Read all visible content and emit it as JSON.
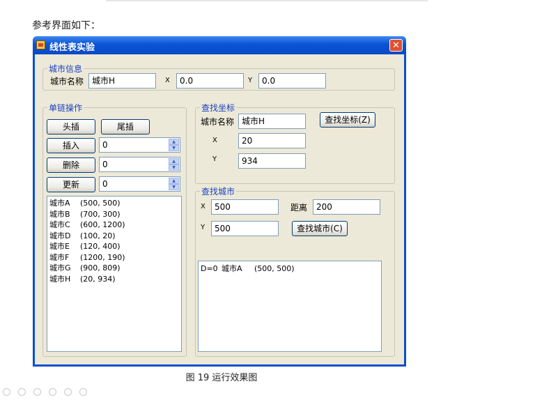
{
  "document": {
    "intro": "参考界面如下：",
    "caption": "图 19  运行效果图"
  },
  "window": {
    "title": "线性表实验",
    "close_glyph": "✕"
  },
  "city_info": {
    "legend": "城市信息",
    "name_label": "城市名称",
    "name_value": "城市H",
    "x_label": "X",
    "x_value": "0.0",
    "y_label": "Y",
    "y_value": "0.0"
  },
  "list_ops": {
    "legend": "单链操作",
    "head_insert": "头插",
    "tail_insert": "尾插",
    "insert": "插入",
    "insert_value": "0",
    "delete": "删除",
    "delete_value": "0",
    "update": "更新",
    "update_value": "0",
    "cities": [
      {
        "name": "城市A",
        "coords": "(500, 500)"
      },
      {
        "name": "城市B",
        "coords": "(700, 300)"
      },
      {
        "name": "城市C",
        "coords": "(600, 1200)"
      },
      {
        "name": "城市D",
        "coords": "(100, 20)"
      },
      {
        "name": "城市E",
        "coords": "(120, 400)"
      },
      {
        "name": "城市F",
        "coords": "(1200, 190)"
      },
      {
        "name": "城市G",
        "coords": "(900, 809)"
      },
      {
        "name": "城市H",
        "coords": "(20, 934)"
      }
    ]
  },
  "find_coords": {
    "legend": "查找坐标",
    "name_label": "城市名称",
    "name_value": "城市H",
    "button": "查找坐标(Z)",
    "x_label": "X",
    "x_value": "20",
    "y_label": "Y",
    "y_value": "934"
  },
  "find_city": {
    "legend": "查找城市",
    "x_label": "X",
    "x_value": "500",
    "distance_label": "距离",
    "distance_value": "200",
    "y_label": "Y",
    "y_value": "500",
    "button": "查找城市(C)",
    "results": [
      {
        "d": "D=0",
        "name": "城市A",
        "coords": "(500, 500)"
      }
    ]
  }
}
